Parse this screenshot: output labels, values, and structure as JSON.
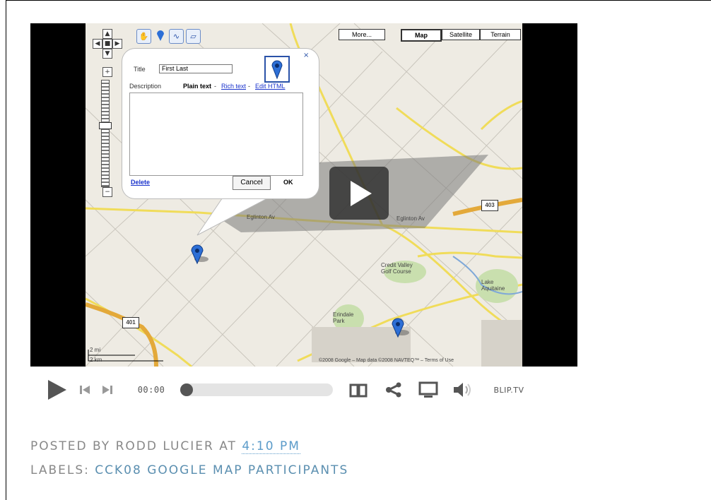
{
  "map": {
    "zoom_plus": "+",
    "zoom_minus": "−",
    "maptypes": {
      "more": "More...",
      "map": "Map",
      "satellite": "Satellite",
      "terrain": "Terrain"
    },
    "popup": {
      "title_label": "Title",
      "title_value": "First Last",
      "description_label": "Description",
      "rich_text": "Plain text",
      "rich_link": "Rich text",
      "html_link": "Edit HTML",
      "sep1": " - ",
      "sep2": " - ",
      "delete_label": "Delete",
      "cancel_label": "Cancel",
      "ok_label": "OK",
      "close_label": "×"
    },
    "highway_401": "401",
    "highway_403": "403",
    "road_label": "Eglinton Av",
    "place_1": "Credit Valley Golf Course",
    "place_2": "Erindale Park",
    "place_3": "Lake Aquitaine",
    "scale_upper": "2 mi",
    "scale_lower": "2 km",
    "attribution": "©2008 Google – Map data ©2008 NAVTEQ™ – Terms of Use"
  },
  "player": {
    "time": "00:00",
    "progress": 0,
    "brand": "BLIP.TV"
  },
  "post": {
    "posted_by_prefix": "POSTED BY RODD LUCIER AT ",
    "time": "4:10 PM",
    "labels_prefix": "LABELS: ",
    "label_link": "CCK08 GOOGLE MAP PARTICIPANTS"
  },
  "colors": {
    "accent": "#5b9bc9",
    "map_bg": "#eeebe3",
    "road": "#f7e96e",
    "highway": "#e8b84a",
    "marker": "#2d6fd6"
  }
}
